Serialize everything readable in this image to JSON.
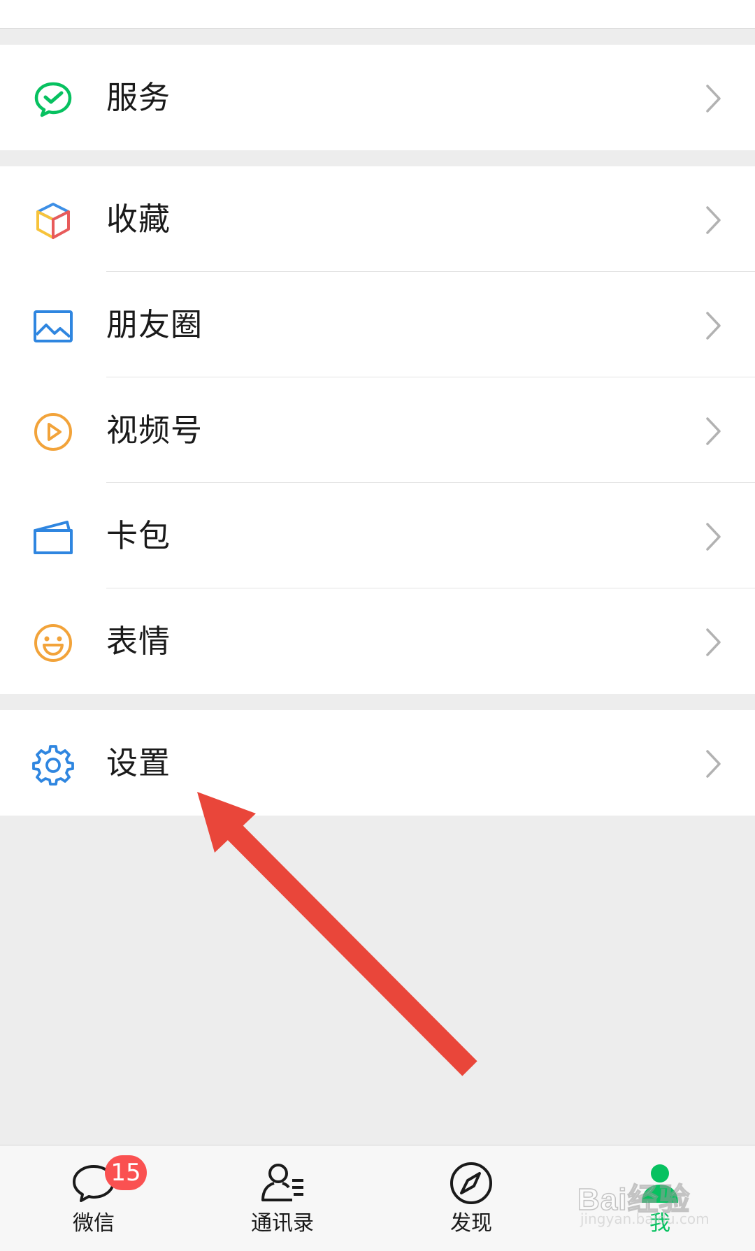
{
  "groups": [
    {
      "items": [
        {
          "label": "服务",
          "icon": "wechat-pay-icon"
        }
      ]
    },
    {
      "items": [
        {
          "label": "收藏",
          "icon": "favorites-cube-icon"
        },
        {
          "label": "朋友圈",
          "icon": "moments-picture-icon"
        },
        {
          "label": "视频号",
          "icon": "channels-play-icon"
        },
        {
          "label": "卡包",
          "icon": "card-wallet-icon"
        },
        {
          "label": "表情",
          "icon": "sticker-smile-icon"
        }
      ]
    },
    {
      "items": [
        {
          "label": "设置",
          "icon": "gear-icon"
        }
      ]
    }
  ],
  "tabbar": {
    "tabs": [
      {
        "label": "微信",
        "icon": "chat-bubble-icon",
        "badge": "15",
        "active": false
      },
      {
        "label": "通讯录",
        "icon": "contacts-icon",
        "active": false
      },
      {
        "label": "发现",
        "icon": "compass-icon",
        "active": false
      },
      {
        "label": "我",
        "icon": "person-icon",
        "active": true
      }
    ]
  },
  "watermark": {
    "main": "Bai经验",
    "sub": "jingyan.baidu.com"
  },
  "colors": {
    "accent_green": "#07c160",
    "badge_red": "#fa5151",
    "arrow_red": "#e9463a",
    "background": "#ededed"
  }
}
